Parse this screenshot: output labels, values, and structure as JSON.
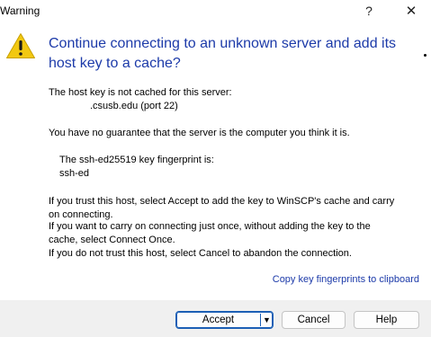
{
  "window": {
    "title": "Warning",
    "help_glyph": "?",
    "close_glyph": "✕"
  },
  "icon": {
    "name": "warning-icon",
    "color": "#f2c811"
  },
  "heading": {
    "line1": "Continue connecting to an unknown server and add its",
    "line2": "host key to a cache?"
  },
  "body": {
    "not_cached": "The host key is not cached for this server:",
    "server": ".csusb.edu (port 22)",
    "no_guarantee": "You have no guarantee that the server is the computer you think it is.",
    "fingerprint_label": "The ssh-ed25519 key fingerprint is:",
    "fingerprint_value": "ssh-ed",
    "trust_line1": "If you trust this host, select Accept to add the key to WinSCP's cache and carry",
    "trust_line2": "on connecting.",
    "once_line1": "If you want to carry on connecting just once, without adding the key to the",
    "once_line2": "cache, select Connect Once.",
    "cancel_line": "If you do not trust this host, select Cancel to abandon the connection."
  },
  "link": {
    "copy_fingerprints": "Copy key fingerprints to clipboard"
  },
  "buttons": {
    "accept": "Accept",
    "accept_dropdown_glyph": "▼",
    "cancel": "Cancel",
    "help": "Help"
  },
  "colors": {
    "heading": "#1c3aa9",
    "link": "#1c3aa9",
    "default_button_border": "#1c5fb5",
    "button_bar": "#f0f0f0"
  }
}
